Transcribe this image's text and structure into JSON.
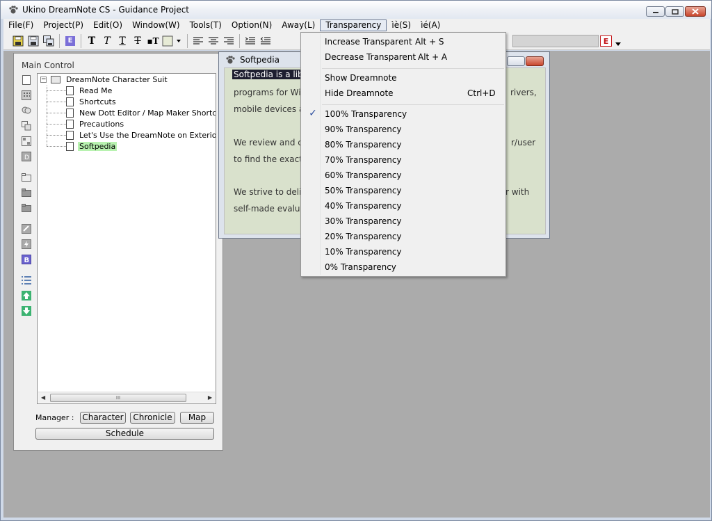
{
  "window": {
    "title": "Ukino DreamNote CS - Guidance Project"
  },
  "menubar": {
    "items": [
      "File(F)",
      "Project(P)",
      "Edit(O)",
      "Window(W)",
      "Tools(T)",
      "Option(N)",
      "Away(L)",
      "Transparency",
      "ìè(S)",
      "ìé(A)"
    ]
  },
  "toolbar": {
    "e_label": "E",
    "edit_e_label": "E"
  },
  "panel": {
    "title": "Main Control",
    "tree": {
      "root": "DreamNote Character Suit",
      "items": [
        "Read Me",
        "Shortcuts",
        "New Dott Editor / Map Maker Shortcuts",
        "Precautions",
        "Let's Use the DreamNote on Exterior Com",
        "Softpedia"
      ],
      "selected": "Softpedia"
    },
    "scroll_thumb": "III",
    "manager_label": "Manager :",
    "buttons": {
      "character": "Character",
      "chronicle": "Chronicle",
      "map": "Map",
      "schedule": "Schedule"
    }
  },
  "note": {
    "title": "Softpedia",
    "lines": {
      "l1": "Softpedia is a libr",
      "l2": "programs for Win",
      "l2r": "rivers,",
      "l3": "mobile devices an",
      "l4": "We review and c",
      "l4r": "r/user",
      "l5": "to find the exact",
      "l6": "We strive to deliv",
      "l6r": "r with",
      "l7": "self-made evalua"
    }
  },
  "dropdown": {
    "increase": {
      "label": "Increase Transparent",
      "shortcut": "Alt + S"
    },
    "decrease": {
      "label": "Decrease Transparent",
      "shortcut": "Alt + A"
    },
    "show": {
      "label": "Show Dreamnote"
    },
    "hide": {
      "label": "Hide Dreamnote",
      "shortcut": "Ctrl+D"
    },
    "levels": [
      "100% Transparency",
      "90% Transparency",
      "80% Transparency",
      "70% Transparency",
      "60% Transparency",
      "50% Transparency",
      "40% Transparency",
      "30% Transparency",
      "20% Transparency",
      "10% Transparency",
      "0% Transparency"
    ],
    "checked": "100% Transparency"
  },
  "colors": {
    "tree_selected": "#b8f2b0",
    "note_bg": "#d9e1cc",
    "workspace": "#ababab"
  }
}
